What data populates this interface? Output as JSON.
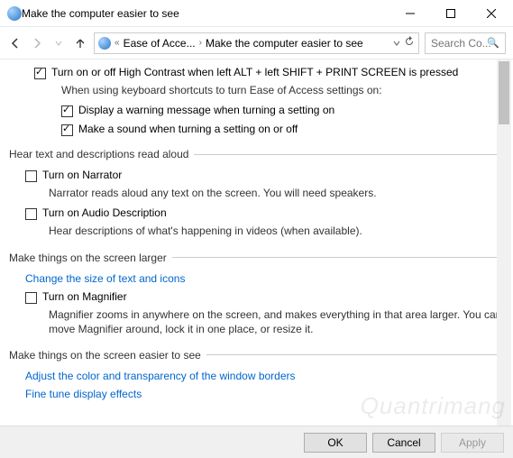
{
  "window": {
    "title": "Make the computer easier to see"
  },
  "breadcrumb": {
    "seg1": "Ease of Acce...",
    "seg2": "Make the computer easier to see"
  },
  "search": {
    "placeholder": "Search Co..."
  },
  "options": {
    "high_contrast": {
      "label": "Turn on or off High Contrast when left ALT + left SHIFT + PRINT SCREEN is pressed",
      "helper": "When using keyboard shortcuts to turn Ease of Access settings on:",
      "sub_warning": "Display a warning message when turning a setting on",
      "sub_sound": "Make a sound when turning a setting on or off"
    }
  },
  "groups": {
    "hear": {
      "legend": "Hear text and descriptions read aloud",
      "narrator": {
        "label": "Turn on Narrator",
        "desc": "Narrator reads aloud any text on the screen. You will need speakers."
      },
      "audio": {
        "label": "Turn on Audio Description",
        "desc": "Hear descriptions of what's happening in videos (when available)."
      }
    },
    "larger": {
      "legend": "Make things on the screen larger",
      "link": "Change the size of text and icons",
      "magnifier": {
        "label": "Turn on Magnifier",
        "desc": "Magnifier zooms in anywhere on the screen, and makes everything in that area larger. You can move Magnifier around, lock it in one place, or resize it."
      }
    },
    "easier": {
      "legend": "Make things on the screen easier to see",
      "link1": "Adjust the color and transparency of the window borders",
      "link2": "Fine tune display effects"
    }
  },
  "buttons": {
    "ok": "OK",
    "cancel": "Cancel",
    "apply": "Apply"
  },
  "watermark": "Quantrimang"
}
